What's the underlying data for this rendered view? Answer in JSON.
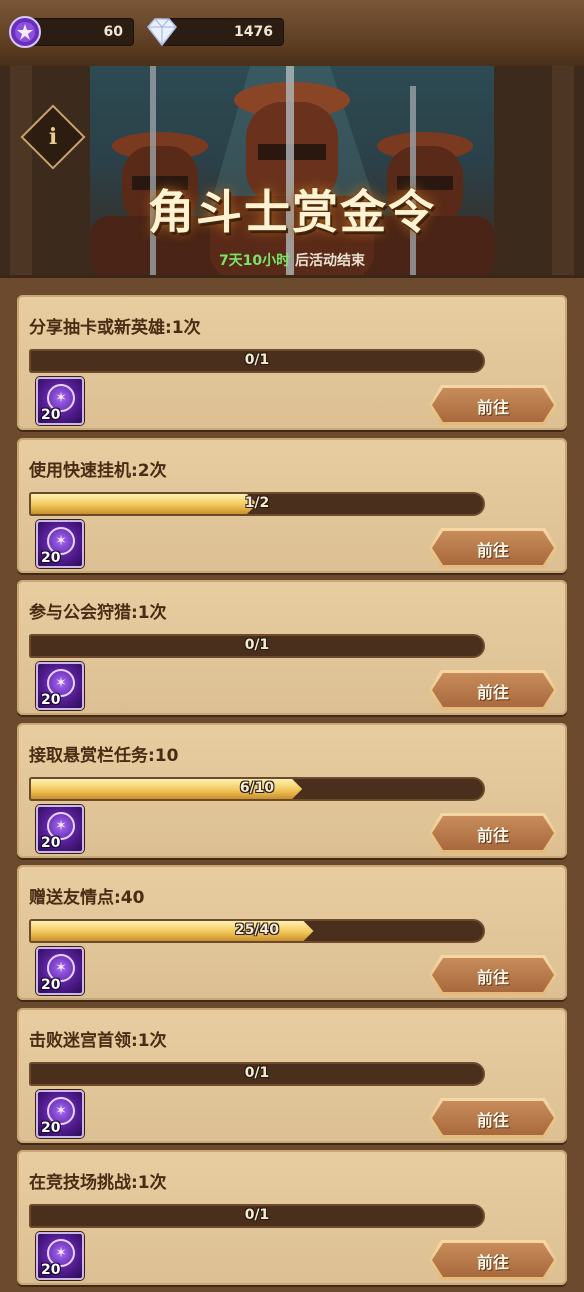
{
  "currencies": {
    "bounty_tokens": "60",
    "diamonds": "1476"
  },
  "banner": {
    "title": "角斗士赏金令",
    "time_left": "7天10小时",
    "time_suffix": " 后活动结束",
    "info_icon_label": "i"
  },
  "tasks": [
    {
      "title": "分享抽卡或新英雄:1次",
      "progress_text": "0/1",
      "progress": 0.0,
      "reward_amount": "20",
      "button_label": "前往"
    },
    {
      "title": "使用快速挂机:2次",
      "progress_text": "1/2",
      "progress": 0.5,
      "reward_amount": "20",
      "button_label": "前往"
    },
    {
      "title": "参与公会狩猎:1次",
      "progress_text": "0/1",
      "progress": 0.0,
      "reward_amount": "20",
      "button_label": "前往"
    },
    {
      "title": "接取悬赏栏任务:10",
      "progress_text": "6/10",
      "progress": 0.6,
      "reward_amount": "20",
      "button_label": "前往"
    },
    {
      "title": "赠送友情点:40",
      "progress_text": "25/40",
      "progress": 0.625,
      "reward_amount": "20",
      "button_label": "前往"
    },
    {
      "title": "击败迷宫首领:1次",
      "progress_text": "0/1",
      "progress": 0.0,
      "reward_amount": "20",
      "button_label": "前往"
    },
    {
      "title": "在竞技场挑战:1次",
      "progress_text": "0/1",
      "progress": 0.0,
      "reward_amount": "20",
      "button_label": "前往"
    }
  ],
  "colors": {
    "progress_fill": "#f2c65a",
    "time_accent": "#7be26a",
    "reward_purple": "#6a2fb8"
  }
}
